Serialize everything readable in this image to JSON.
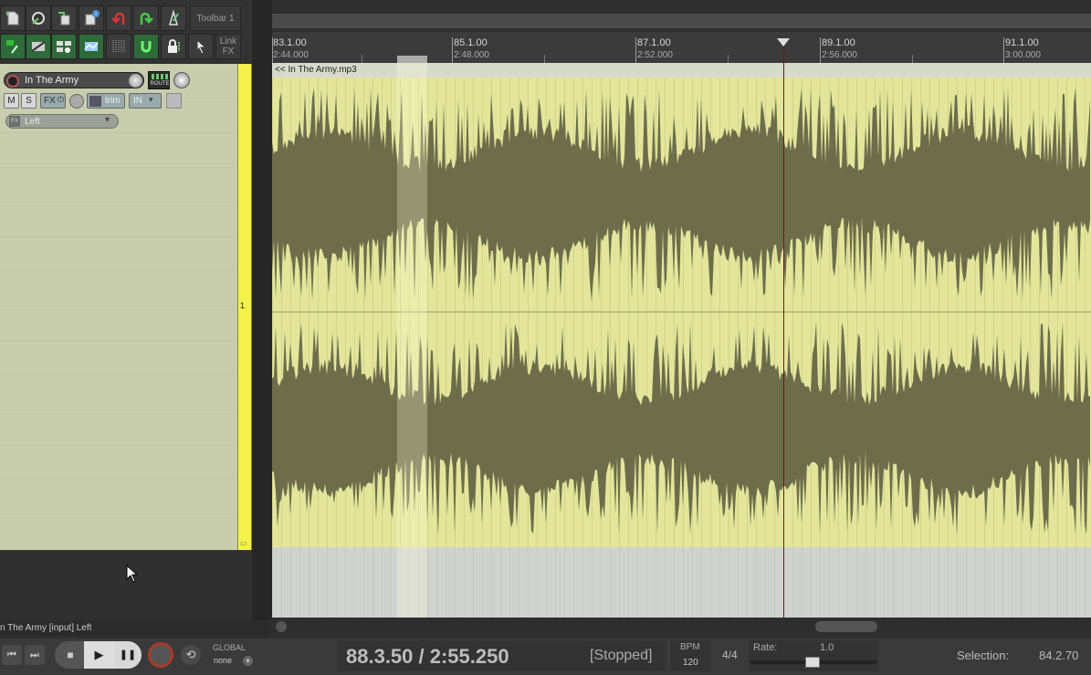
{
  "toolbar": {
    "label": "Toolbar 1",
    "link_fx": [
      "Link",
      "FX"
    ],
    "buttons_row1": [
      "new-project-icon",
      "project-settings-icon",
      "save-project-icon",
      "project-info-icon",
      "undo-icon",
      "redo-icon",
      "metronome-icon"
    ],
    "buttons_row2": [
      "snap-icon",
      "ripple-edit-icon",
      "grid-icon",
      "envelope-icon",
      "grid-lines-icon",
      "loop-icon",
      "lock-icon",
      "cursor-tool-icon"
    ]
  },
  "track": {
    "name": "In The Army",
    "number": "1",
    "route_label": "ROUTE",
    "mute_label": "M",
    "solo_label": "S",
    "fx_label": "FX",
    "trim_label": "trim",
    "in_label": "IN",
    "input_label": "Left",
    "fx_badge": "FX"
  },
  "ruler": {
    "marks": [
      {
        "bar": "83.1.00",
        "time": "2:44.000"
      },
      {
        "bar": "85.1.00",
        "time": "2:48.000"
      },
      {
        "bar": "87.1.00",
        "time": "2:52.000"
      },
      {
        "bar": "89.1.00",
        "time": "2:56.000"
      },
      {
        "bar": "91.1.00",
        "time": "3:00.000"
      }
    ]
  },
  "media_item": {
    "name": "<< In The Army.mp3"
  },
  "status_bar": {
    "text": "n The Army [input] Left"
  },
  "transport": {
    "position": "88.3.50 / 2:55.250",
    "state": "[Stopped]",
    "bpm_label": "BPM",
    "bpm": "120",
    "time_signature": "4/4",
    "rate_label": "Rate:",
    "rate": "1.0",
    "selection_label": "Selection:",
    "selection_value": "84.2.70",
    "global_label": "GLOBAL",
    "automation_mode": "none"
  },
  "colors": {
    "track_color": "#f4f14a",
    "item_bg": "#e3e69a",
    "waveform": "#6d6d4c",
    "edit_cursor": "#6b1a12"
  }
}
